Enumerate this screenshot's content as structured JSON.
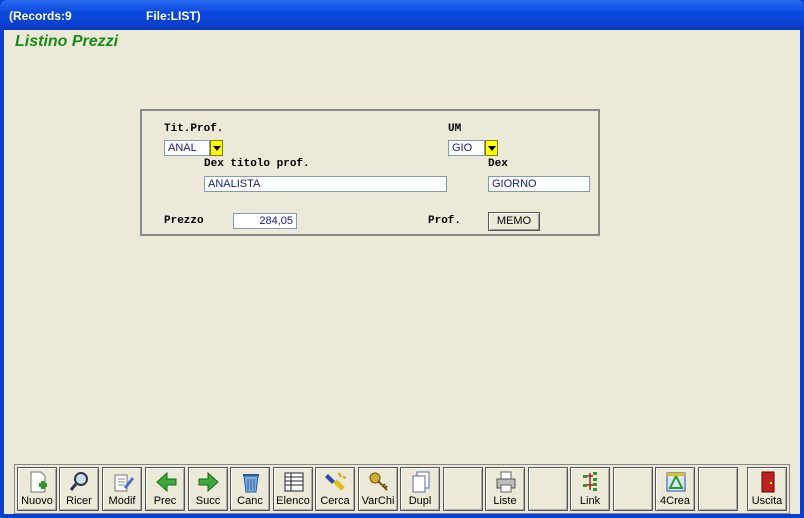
{
  "window": {
    "records_label": "(Records:9",
    "file_label": "File:LIST)"
  },
  "app": {
    "title": "Listino Prezzi"
  },
  "form": {
    "tit_prof": {
      "label": "Tit.Prof.",
      "value": "ANAL"
    },
    "um": {
      "label": "UM",
      "value": "GIO"
    },
    "dex_titolo": {
      "label": "Dex titolo prof.",
      "value": "ANALISTA"
    },
    "dex": {
      "label": "Dex",
      "value": "GIORNO"
    },
    "prezzo": {
      "label": "Prezzo",
      "value": "284,05"
    },
    "prof": {
      "label": "Prof.",
      "button": "MEMO"
    }
  },
  "toolbar": {
    "buttons": [
      {
        "label": "Nuovo",
        "icon": "new-document-icon"
      },
      {
        "label": "Ricer",
        "icon": "magnifier-icon"
      },
      {
        "label": "Modif",
        "icon": "edit-icon"
      },
      {
        "label": "Prec",
        "icon": "arrow-left-icon"
      },
      {
        "label": "Succ",
        "icon": "arrow-right-icon"
      },
      {
        "label": "Canc",
        "icon": "trash-icon"
      },
      {
        "label": "Elenco",
        "icon": "table-icon"
      },
      {
        "label": "Cerca",
        "icon": "flashlight-icon"
      },
      {
        "label": "VarChi",
        "icon": "keys-icon"
      },
      {
        "label": "Dupl",
        "icon": "duplicate-icon"
      },
      {
        "label": "",
        "icon": ""
      },
      {
        "label": "Liste",
        "icon": "printer-icon"
      },
      {
        "label": "",
        "icon": ""
      },
      {
        "label": "Link",
        "icon": "link-tree-icon"
      },
      {
        "label": "",
        "icon": ""
      },
      {
        "label": "4Crea",
        "icon": "design-icon"
      },
      {
        "label": "",
        "icon": ""
      },
      {
        "label": "Uscita",
        "icon": "exit-door-icon"
      }
    ]
  }
}
